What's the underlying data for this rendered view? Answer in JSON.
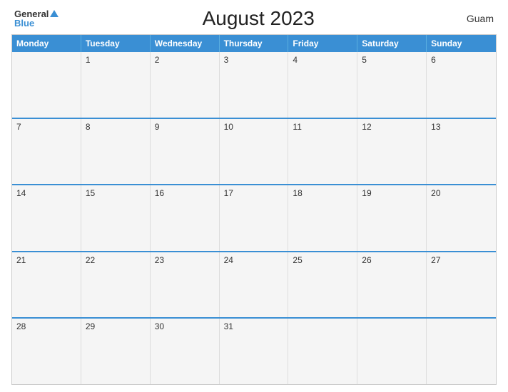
{
  "header": {
    "logo_general": "General",
    "logo_blue": "Blue",
    "title": "August 2023",
    "region": "Guam"
  },
  "calendar": {
    "days": [
      "Monday",
      "Tuesday",
      "Wednesday",
      "Thursday",
      "Friday",
      "Saturday",
      "Sunday"
    ],
    "weeks": [
      [
        null,
        1,
        2,
        3,
        4,
        5,
        6
      ],
      [
        7,
        8,
        9,
        10,
        11,
        12,
        13
      ],
      [
        14,
        15,
        16,
        17,
        18,
        19,
        20
      ],
      [
        21,
        22,
        23,
        24,
        25,
        26,
        27
      ],
      [
        28,
        29,
        30,
        31,
        null,
        null,
        null
      ]
    ]
  }
}
